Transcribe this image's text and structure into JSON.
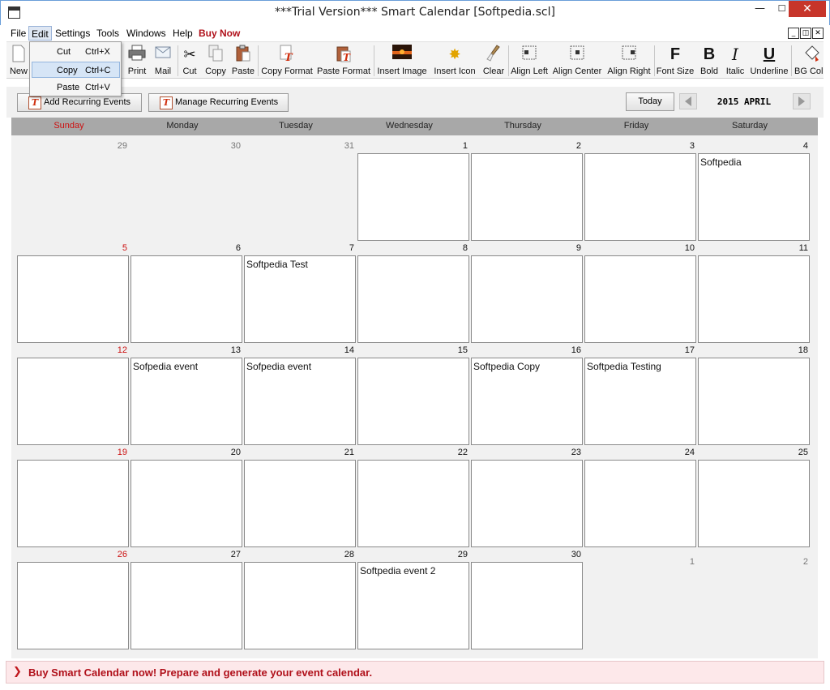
{
  "window": {
    "title": "***Trial Version*** Smart Calendar [Softpedia.scl]"
  },
  "menubar": {
    "items": [
      "File",
      "Edit",
      "Settings",
      "Tools",
      "Windows",
      "Help"
    ],
    "buy_now": "Buy Now"
  },
  "edit_menu": {
    "items": [
      {
        "label": "Cut",
        "shortcut": "Ctrl+X"
      },
      {
        "label": "Copy",
        "shortcut": "Ctrl+C"
      },
      {
        "label": "Paste",
        "shortcut": "Ctrl+V"
      }
    ]
  },
  "toolbar": {
    "items": [
      "New",
      "Print",
      "Mail",
      "Cut",
      "Copy",
      "Paste",
      "Copy Format",
      "Paste Format",
      "Insert Image",
      "Insert Icon",
      "Clear",
      "Align Left",
      "Align Center",
      "Align Right",
      "Font Size",
      "Bold",
      "Italic",
      "Underline",
      "BG Colo"
    ]
  },
  "actions": {
    "add_recurring": "Add Recurring Events",
    "manage_recurring": "Manage Recurring Events",
    "today": "Today",
    "month_label": "2015 APRIL"
  },
  "calendar": {
    "weekdays": [
      "Sunday",
      "Monday",
      "Tuesday",
      "Wednesday",
      "Thursday",
      "Friday",
      "Saturday"
    ],
    "weeks": [
      [
        {
          "day": "29",
          "other": true,
          "event": ""
        },
        {
          "day": "30",
          "other": true,
          "event": ""
        },
        {
          "day": "31",
          "other": true,
          "event": ""
        },
        {
          "day": "1",
          "event": ""
        },
        {
          "day": "2",
          "event": ""
        },
        {
          "day": "3",
          "event": ""
        },
        {
          "day": "4",
          "event": "Softpedia"
        }
      ],
      [
        {
          "day": "5",
          "event": ""
        },
        {
          "day": "6",
          "event": ""
        },
        {
          "day": "7",
          "event": "Softpedia Test"
        },
        {
          "day": "8",
          "event": ""
        },
        {
          "day": "9",
          "event": ""
        },
        {
          "day": "10",
          "event": ""
        },
        {
          "day": "11",
          "event": ""
        }
      ],
      [
        {
          "day": "12",
          "event": ""
        },
        {
          "day": "13",
          "event": "Sofpedia event"
        },
        {
          "day": "14",
          "event": "Sofpedia event"
        },
        {
          "day": "15",
          "event": ""
        },
        {
          "day": "16",
          "event": "Softpedia Copy"
        },
        {
          "day": "17",
          "event": "Softpedia Testing"
        },
        {
          "day": "18",
          "event": ""
        }
      ],
      [
        {
          "day": "19",
          "event": ""
        },
        {
          "day": "20",
          "event": ""
        },
        {
          "day": "21",
          "event": ""
        },
        {
          "day": "22",
          "event": ""
        },
        {
          "day": "23",
          "event": ""
        },
        {
          "day": "24",
          "event": ""
        },
        {
          "day": "25",
          "event": ""
        }
      ],
      [
        {
          "day": "26",
          "event": ""
        },
        {
          "day": "27",
          "event": ""
        },
        {
          "day": "28",
          "event": ""
        },
        {
          "day": "29",
          "event": "Softpedia event 2"
        },
        {
          "day": "30",
          "event": ""
        },
        {
          "day": "1",
          "other": true,
          "event": ""
        },
        {
          "day": "2",
          "other": true,
          "event": ""
        }
      ]
    ]
  },
  "banner": {
    "text": "Buy Smart Calendar now! Prepare and generate your event calendar."
  },
  "colors": {
    "accent_red": "#b0101a",
    "sunday_red": "#cc1111",
    "header_gray": "#a8a8a8",
    "banner_bg": "#fde8ea"
  }
}
